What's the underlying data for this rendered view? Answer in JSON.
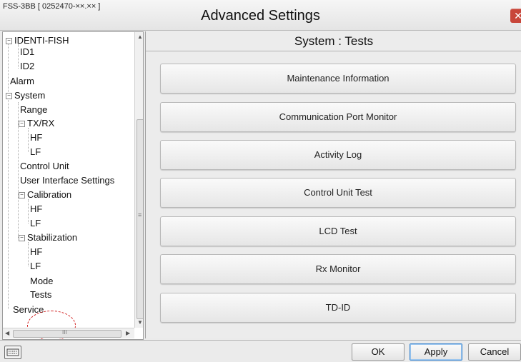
{
  "window": {
    "model_label": "FSS-3BB [ 0252470-××.×× ]",
    "title": "Advanced Settings",
    "close_icon": "close-icon",
    "close_glyph": "✕"
  },
  "tree": {
    "items": [
      {
        "label": "IDENTI-FISH",
        "expander": "−"
      },
      {
        "label": "ID1"
      },
      {
        "label": "ID2"
      },
      {
        "label": "Alarm"
      },
      {
        "label": "System",
        "expander": "−"
      },
      {
        "label": "Range"
      },
      {
        "label": "TX/RX",
        "expander": "−"
      },
      {
        "label": "HF"
      },
      {
        "label": "LF"
      },
      {
        "label": "Control Unit"
      },
      {
        "label": "User Interface Settings"
      },
      {
        "label": "Calibration",
        "expander": "−"
      },
      {
        "label": "HF"
      },
      {
        "label": "LF"
      },
      {
        "label": "Stabilization",
        "expander": "−"
      },
      {
        "label": "HF"
      },
      {
        "label": "LF"
      },
      {
        "label": "Mode"
      },
      {
        "label": "Tests",
        "highlighted": true
      },
      {
        "label": "Service"
      }
    ],
    "scroll_grip": "≡",
    "hscroll_grip": "III",
    "arrow_up": "▲",
    "arrow_down": "▼",
    "arrow_left": "◀",
    "arrow_right": "▶",
    "highlight_color": "#d12020"
  },
  "main": {
    "section_title": "System : Tests",
    "buttons": [
      "Maintenance Information",
      "Communication Port Monitor",
      "Activity Log",
      "Control Unit Test",
      "LCD Test",
      "Rx Monitor",
      "TD-ID"
    ]
  },
  "footer": {
    "keyboard_icon": "keyboard-icon",
    "ok": "OK",
    "apply": "Apply",
    "cancel": "Cancel"
  }
}
